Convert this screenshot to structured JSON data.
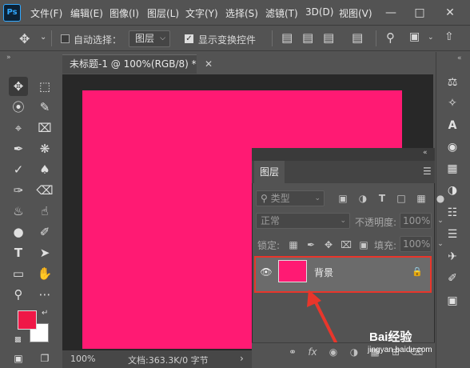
{
  "app": {
    "logo": "Ps"
  },
  "menubar": {
    "items": [
      "文件(F)",
      "编辑(E)",
      "图像(I)",
      "图层(L)",
      "文字(Y)",
      "选择(S)",
      "滤镜(T)",
      "3D(D)",
      "视图(V)"
    ],
    "window_controls": [
      "minimize-icon",
      "maximize-icon",
      "close-icon"
    ]
  },
  "options_bar": {
    "auto_select_label": "自动选择：",
    "auto_select_checked": false,
    "mode_value": "图层",
    "show_transform_label": "显示变换控件",
    "show_transform_checked": true
  },
  "document": {
    "tab_title": "未标题-1 @ 100%(RGB/8) *",
    "canvas_color": "#ff1a73",
    "zoom": "100%",
    "doc_info": "文档:363.3K/0 字节"
  },
  "toolbar": {
    "foreground_color": "#ef1847",
    "background_color": "#ffffff"
  },
  "layers_panel": {
    "tab_label": "图层",
    "filter_kind": "类型",
    "blend_mode": "正常",
    "opacity_label": "不透明度:",
    "opacity_value": "100%",
    "lock_label": "锁定:",
    "fill_label": "填充:",
    "fill_value": "100%",
    "layers": [
      {
        "name": "背景",
        "visible": true,
        "locked": true,
        "thumb_color": "#ff1a73"
      }
    ],
    "bottom_icons": [
      "link-icon",
      "fx-icon",
      "mask-icon",
      "adjustment-icon",
      "group-icon",
      "new-layer-icon",
      "trash-icon"
    ]
  },
  "annotation": {
    "color": "#e8362b"
  },
  "watermark": {
    "text": "Bai经验",
    "sub": "jingyan.baidu.com"
  }
}
